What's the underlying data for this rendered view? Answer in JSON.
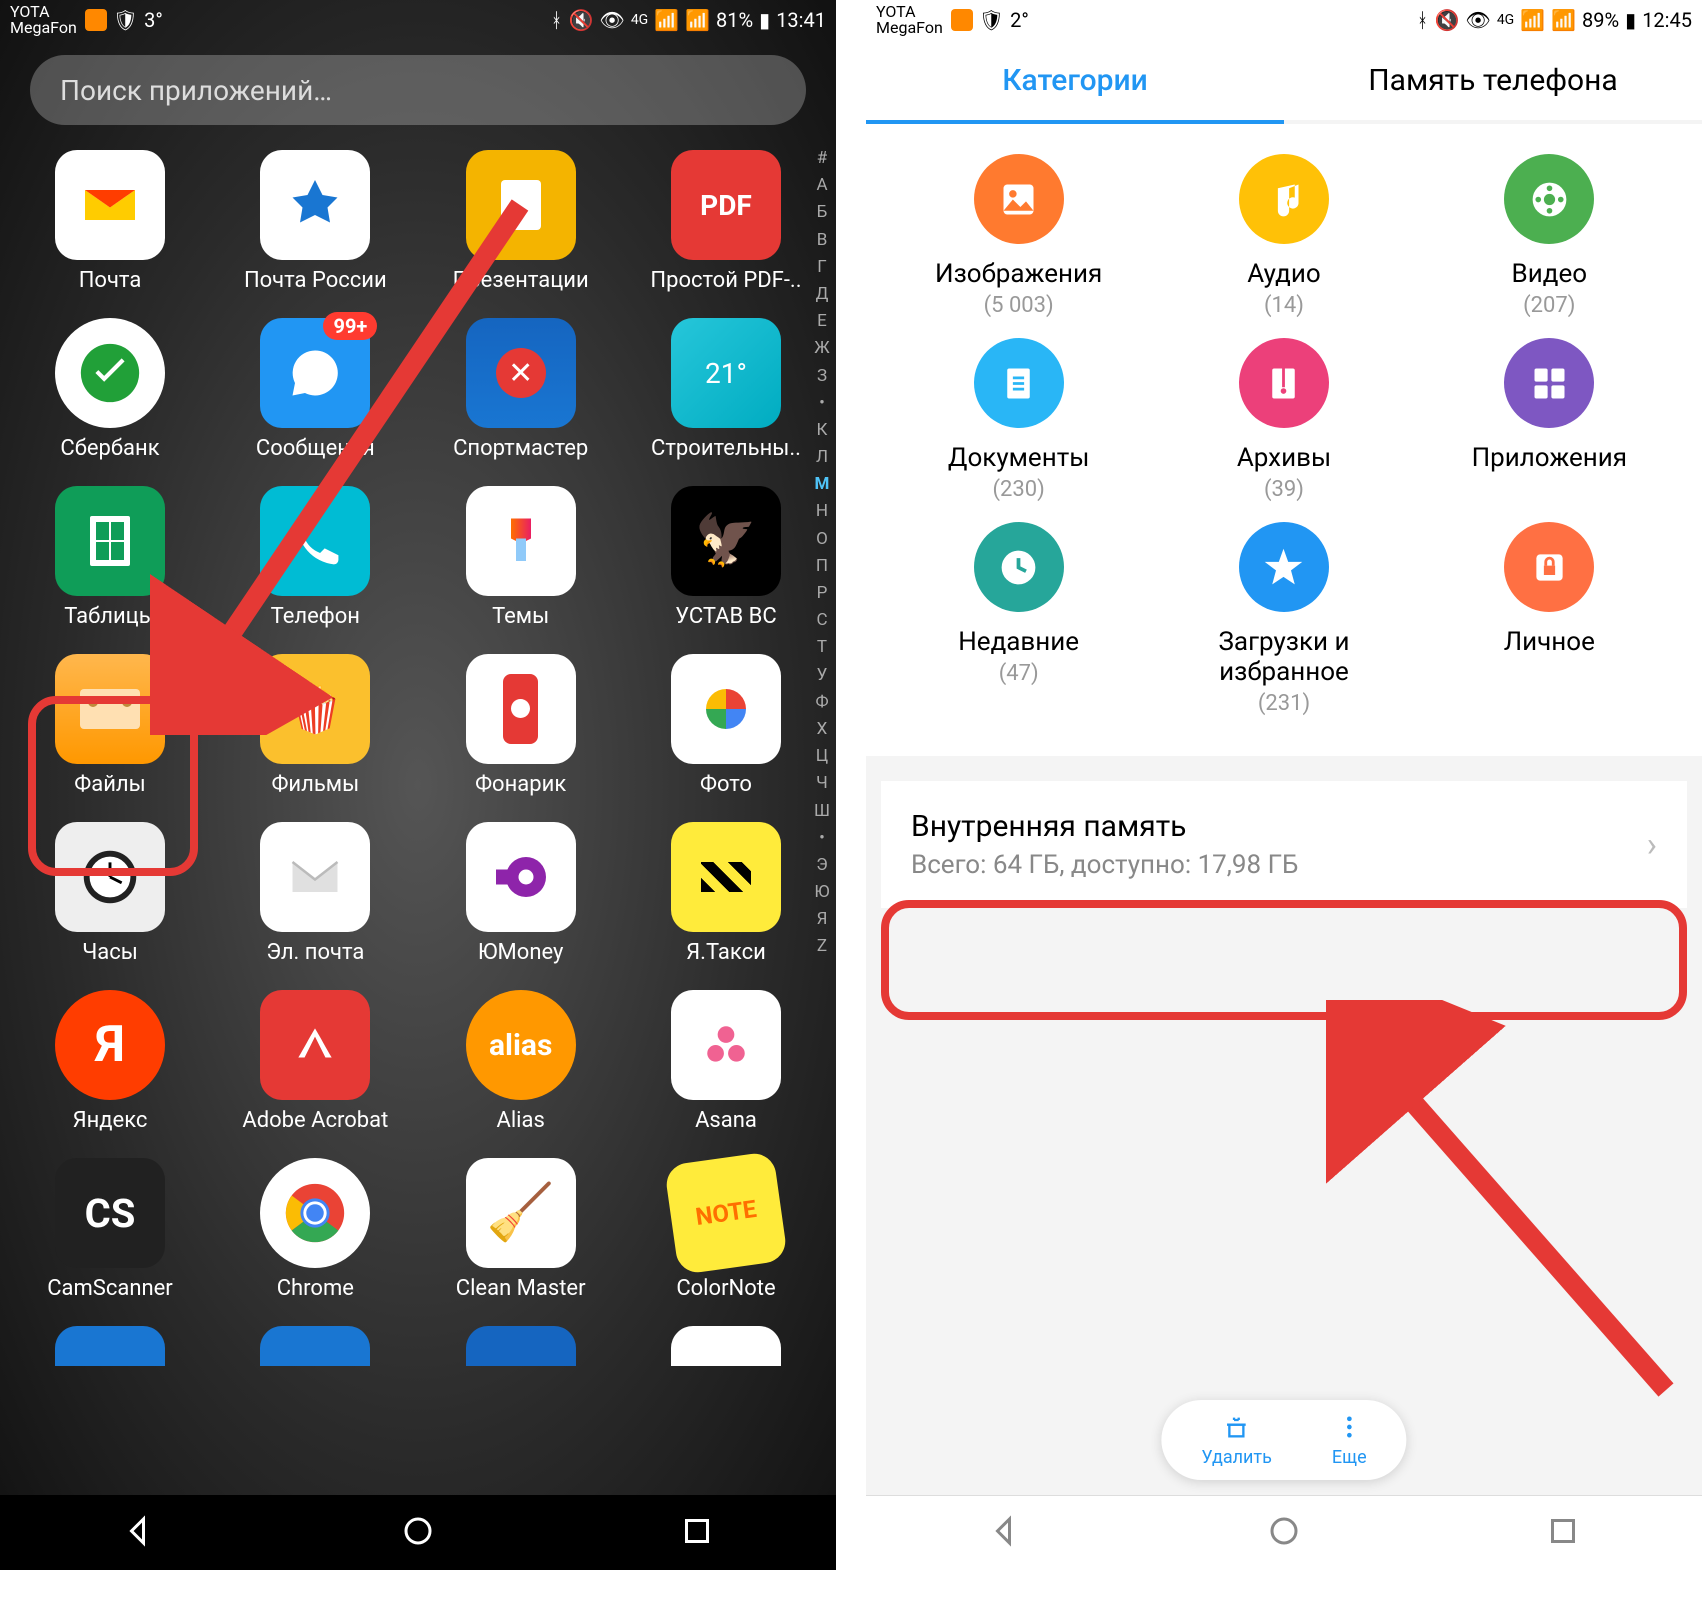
{
  "left": {
    "status": {
      "carrier": "YOTA\nMegaFon",
      "temp": "3°",
      "battery": "81%",
      "time": "13:41",
      "net": "4G"
    },
    "search": {
      "placeholder": "Поиск приложений…"
    },
    "apps": [
      [
        {
          "label": "Почта"
        },
        {
          "label": "Почта России"
        },
        {
          "label": "Презентации"
        },
        {
          "label": "Простой PDF-.."
        }
      ],
      [
        {
          "label": "Сбербанк"
        },
        {
          "label": "Сообщения",
          "badge": "99+"
        },
        {
          "label": "Спортмастер"
        },
        {
          "label": "Строительны.."
        }
      ],
      [
        {
          "label": "Таблицы"
        },
        {
          "label": "Телефон"
        },
        {
          "label": "Темы"
        },
        {
          "label": "УСТАВ ВС"
        }
      ],
      [
        {
          "label": "Файлы"
        },
        {
          "label": "Фильмы"
        },
        {
          "label": "Фонарик"
        },
        {
          "label": "Фото"
        }
      ],
      [
        {
          "label": "Часы"
        },
        {
          "label": "Эл. почта"
        },
        {
          "label": "ЮMoney"
        },
        {
          "label": "Я.Такси"
        }
      ],
      [
        {
          "label": "Яндекс"
        },
        {
          "label": "Adobe Acrobat"
        },
        {
          "label": "Alias"
        },
        {
          "label": "Asana"
        }
      ],
      [
        {
          "label": "CamScanner"
        },
        {
          "label": "Chrome"
        },
        {
          "label": "Clean Master"
        },
        {
          "label": "ColorNote"
        }
      ]
    ],
    "alphabet": [
      "#",
      "А",
      "Б",
      "В",
      "Г",
      "Д",
      "Е",
      "Ж",
      "З",
      "•",
      "К",
      "Л",
      "М",
      "Н",
      "О",
      "П",
      "Р",
      "С",
      "Т",
      "У",
      "Ф",
      "Х",
      "Ц",
      "Ч",
      "Ш",
      "•",
      "Э",
      "Ю",
      "Я",
      "Z"
    ],
    "highlight_letter": "М"
  },
  "right": {
    "status": {
      "carrier": "YOTA\nMegaFon",
      "temp": "2°",
      "battery": "89%",
      "time": "12:45",
      "net": "4G"
    },
    "tabs": {
      "active": "Категории",
      "inactive": "Память телефона"
    },
    "categories": [
      [
        {
          "t": "Изображения",
          "c": "(5 003)",
          "bg": "#ff7a2f",
          "icon": "image"
        },
        {
          "t": "Аудио",
          "c": "(14)",
          "bg": "#ffc107",
          "icon": "music"
        },
        {
          "t": "Видео",
          "c": "(207)",
          "bg": "#4caf50",
          "icon": "video"
        }
      ],
      [
        {
          "t": "Документы",
          "c": "(230)",
          "bg": "#29b6f6",
          "icon": "doc"
        },
        {
          "t": "Архивы",
          "c": "(39)",
          "bg": "#ec407a",
          "icon": "zip"
        },
        {
          "t": "Приложения",
          "c": "",
          "bg": "#7e57c2",
          "icon": "apps"
        }
      ],
      [
        {
          "t": "Недавние",
          "c": "(47)",
          "bg": "#26a69a",
          "icon": "clock"
        },
        {
          "t": "Загрузки и избранное",
          "c": "(231)",
          "bg": "#2196f3",
          "icon": "star"
        },
        {
          "t": "Личное",
          "c": "",
          "bg": "#ff7043",
          "icon": "lock"
        }
      ]
    ],
    "storage": {
      "title": "Внутренняя память",
      "subtitle": "Всего: 64 ГБ, доступно: 17,98 ГБ"
    },
    "fab": {
      "delete": "Удалить",
      "more": "Еще"
    }
  }
}
